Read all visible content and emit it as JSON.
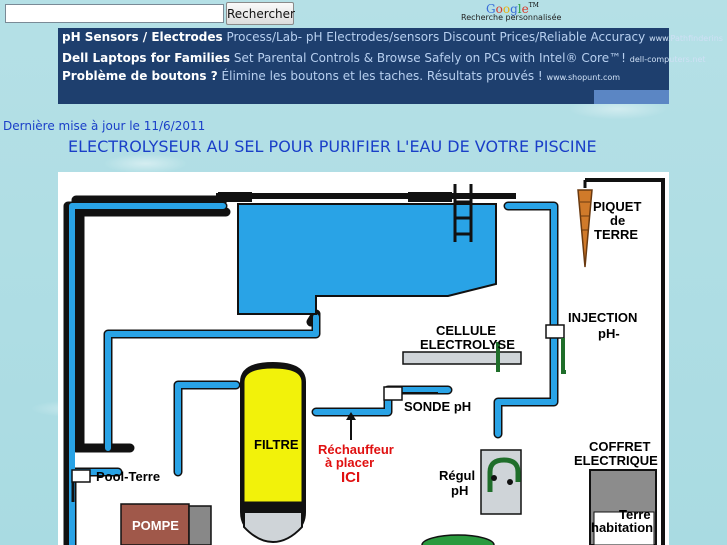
{
  "search": {
    "placeholder": "",
    "button_label": "Rechercher",
    "logo_letters": [
      "G",
      "o",
      "o",
      "g",
      "l",
      "e"
    ],
    "logo_tm": "TM",
    "caption": "Recherche personnalisée"
  },
  "ads": [
    {
      "title": "pH Sensors / Electrodes",
      "desc": "Process/Lab- pH Electrodes/sensors Discount Prices/Reliable Accuracy",
      "url": "www.Pathfinderins"
    },
    {
      "title": "Dell Laptops for Families",
      "desc": "Set Parental Controls & Browse Safely on PCs with Intel® Core™!",
      "url": "dell-computers.net"
    },
    {
      "title": "Problème de boutons ?",
      "desc": "Élimine les boutons et les taches. Résultats prouvés !",
      "url": "www.shopunt.com"
    }
  ],
  "update_text": "Dernière mise à jour le 11/6/2011",
  "page_title": "ELECTROLYSEUR AU SEL POUR PURIFIER L'EAU DE VOTRE PISCINE",
  "diagram": {
    "labels": {
      "piquet": "PIQUET",
      "de": "de",
      "terre": "TERRE",
      "injection": "INJECTION",
      "ph_minus": "pH-",
      "cellule": "CELLULE",
      "electrolyse": "ELECTROLYSE",
      "sonde": "SONDE pH",
      "filtre": "FILTRE",
      "rechauffeur": "Réchauffeur",
      "a_placer": "à placer",
      "ici": "ICI",
      "pool_terre": "Pool-Terre",
      "pompe": "POMPE",
      "regul": "Régul",
      "ph": "pH",
      "coffret": "COFFRET",
      "electrique": "ELECTRIQUE",
      "terre2": "Terre",
      "habitation": "habitation"
    }
  },
  "colors": {
    "pipe": "#29a3e6",
    "pipe_outline": "#1a1a1a",
    "filter": "#f2f20a",
    "pump": "#a0584a",
    "ground_pipe": "#1f6e2a",
    "link": "#1a3fc8",
    "ad_bg": "#1e3f6e"
  },
  "google_colors": [
    "#3a6ed8",
    "#d83a2c",
    "#e8b010",
    "#3a6ed8",
    "#2ca040",
    "#d83a2c"
  ]
}
